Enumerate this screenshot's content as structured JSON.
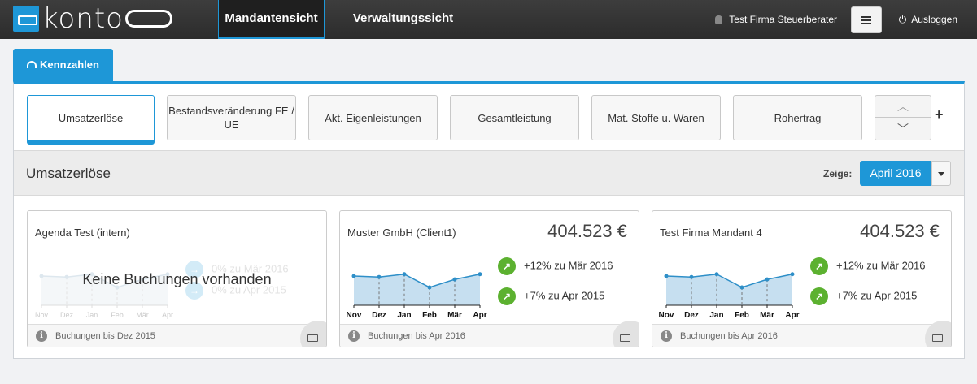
{
  "app": {
    "logo_text": "konto",
    "nav": [
      {
        "label": "Mandantensicht",
        "active": true
      },
      {
        "label": "Verwaltungssicht",
        "active": false
      }
    ],
    "user": "Test Firma Steuerberater",
    "logout": "Ausloggen"
  },
  "kennzahlen_tab": "Kennzahlen",
  "metrics": [
    {
      "label": "Umsatzerlöse",
      "active": true
    },
    {
      "label": "Bestandsveränderung FE / UE",
      "active": false
    },
    {
      "label": "Akt. Eigenleistungen",
      "active": false
    },
    {
      "label": "Gesamtleistung",
      "active": false
    },
    {
      "label": "Mat. Stoffe u. Waren",
      "active": false
    },
    {
      "label": "Rohertrag",
      "active": false
    }
  ],
  "section": {
    "title": "Umsatzerlöse",
    "show_label": "Zeige:",
    "selected_month": "April 2016"
  },
  "months": [
    "Nov",
    "Dez",
    "Jan",
    "Feb",
    "Mär",
    "Apr"
  ],
  "cards": [
    {
      "title": "Agenda Test (intern)",
      "amount": "",
      "empty_message": "Keine Buchungen vorhanden",
      "delta_month": "0% zu Mär 2016",
      "delta_year": "0% zu Apr 2015",
      "footer": "Buchungen bis Dez 2015",
      "has_data": false
    },
    {
      "title": "Muster GmbH (Client1)",
      "amount": "404.523 €",
      "delta_month": "+12% zu Mär 2016",
      "delta_year": "+7% zu Apr 2015",
      "footer": "Buchungen bis Apr 2016",
      "has_data": true
    },
    {
      "title": "Test Firma Mandant 4",
      "amount": "404.523 €",
      "delta_month": "+12% zu Mär 2016",
      "delta_year": "+7% zu Apr 2015",
      "footer": "Buchungen bis Apr 2016",
      "has_data": true
    }
  ],
  "sparkline": [
    0.62,
    0.6,
    0.66,
    0.38,
    0.55,
    0.66
  ],
  "colors": {
    "accent": "#1e97d7",
    "positive": "#5cb130",
    "topbar": "#333333"
  }
}
